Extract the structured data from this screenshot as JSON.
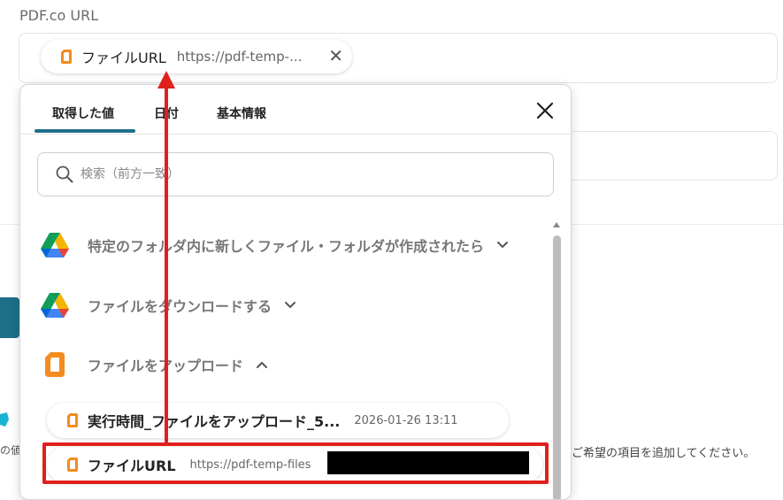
{
  "field": {
    "label": "PDF.co URL",
    "chip_label": "ファイルURL",
    "chip_value": "https://pdf-temp-..."
  },
  "popup": {
    "tabs": [
      "取得した値",
      "日付",
      "基本情報"
    ],
    "active_tab": "取得した値",
    "search_placeholder": "検索（前方一致）",
    "sections": [
      {
        "title": "特定のフォルダ内に新しくファイル・フォルダが作成されたら",
        "icon": "google-drive-icon",
        "expanded": false
      },
      {
        "title": "ファイルをダウンロードする",
        "icon": "google-drive-icon",
        "expanded": false
      },
      {
        "title": "ファイルをアップロード",
        "icon": "pdfco-icon",
        "expanded": true
      }
    ],
    "items": [
      {
        "label": "実行時間_ファイルをアップロード_5...",
        "value": "2026-01-26 13:11"
      },
      {
        "label": "ファイルURL",
        "value": "https://pdf-temp-files"
      }
    ]
  },
  "background": {
    "text_right": "からご希望の項目を追加してください。",
    "text_left": "の値"
  },
  "colors": {
    "accent": "#1f6f8b",
    "highlight": "#e0201c",
    "pdfco_orange": "#f28c1f"
  }
}
